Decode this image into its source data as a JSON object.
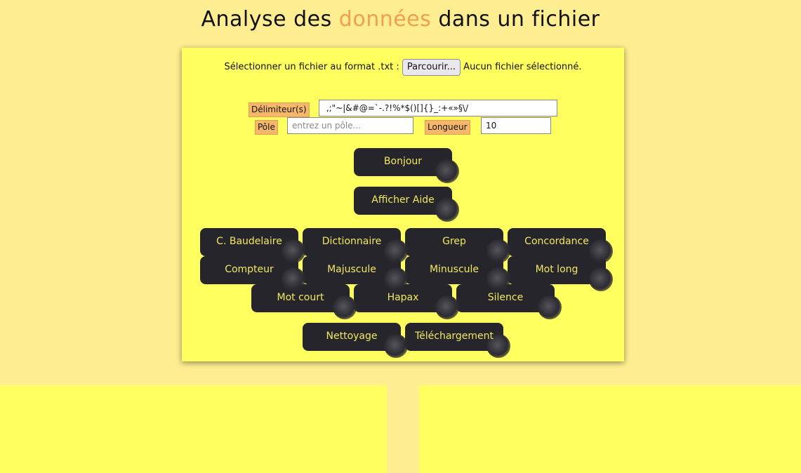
{
  "header": {
    "title_before": "Analyse des",
    "title_accent": "données",
    "title_after": "dans un fichier"
  },
  "file_picker": {
    "label": "Sélectionner un fichier au format .txt :",
    "button_label": "Parcourir...",
    "status": "Aucun fichier sélectionné."
  },
  "form": {
    "delimiters_label": "Délimiteur(s)",
    "delimiters_value": " ,;\"~|&#@=`-.?!%*$()[]{}_:+«»§\\/",
    "pole_label": "Pôle",
    "pole_placeholder": "entrez un pôle...",
    "pole_value": "",
    "length_label": "Longueur",
    "length_value": "10"
  },
  "buttons": {
    "hello": "Bonjour",
    "help": "Afficher Aide",
    "baudelaire": "C. Baudelaire",
    "dictionary": "Dictionnaire",
    "grep": "Grep",
    "concordance": "Concordance",
    "counter": "Compteur",
    "uppercase": "Majuscule",
    "lowercase": "Minuscule",
    "long_word": "Mot long",
    "short_word": "Mot court",
    "hapax": "Hapax",
    "silence": "Silence",
    "cleanup": "Nettoyage",
    "download": "Téléchargement"
  },
  "colors": {
    "page_background": "#ffee91",
    "panel_background": "#ffff60",
    "accent": "#f0a050",
    "button_background": "#26252b",
    "button_text": "#f2e860",
    "label_background": "#f5b86a"
  }
}
